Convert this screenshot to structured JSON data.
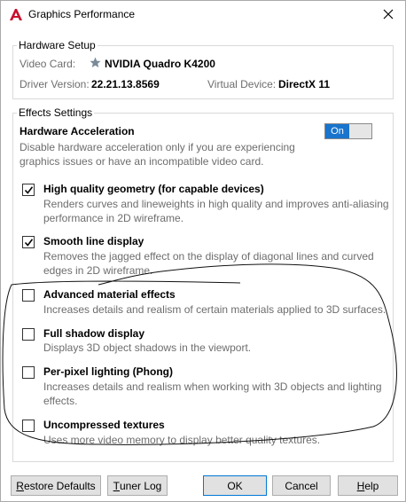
{
  "window": {
    "title": "Graphics Performance"
  },
  "hardware": {
    "legend": "Hardware Setup",
    "video_card_label": "Video Card:",
    "video_card_value": "NVIDIA Quadro K4200",
    "driver_label": "Driver Version:",
    "driver_value": "22.21.13.8569",
    "virtual_label": "Virtual Device:",
    "virtual_value": "DirectX 11"
  },
  "effects": {
    "legend": "Effects Settings",
    "hw_accel_title": "Hardware Acceleration",
    "hw_accel_desc": "Disable hardware acceleration only if you are experiencing graphics issues or have an incompatible video card.",
    "toggle_label": "On",
    "options": [
      {
        "title": "High quality geometry (for capable devices)",
        "desc": "Renders curves and lineweights in high quality and improves anti-aliasing performance in 2D wireframe.",
        "checked": true
      },
      {
        "title": "Smooth line display",
        "desc": "Removes the jagged effect on the display of diagonal lines and curved edges in 2D wireframe.",
        "checked": true
      },
      {
        "title": "Advanced material effects",
        "desc": "Increases details and realism of certain materials applied to 3D surfaces.",
        "checked": false
      },
      {
        "title": "Full shadow display",
        "desc": "Displays 3D object shadows in the viewport.",
        "checked": false
      },
      {
        "title": "Per-pixel lighting (Phong)",
        "desc": "Increases details and realism when working with 3D objects and lighting effects.",
        "checked": false
      },
      {
        "title": "Uncompressed textures",
        "desc": "Uses more video memory to display better quality textures.",
        "checked": false
      }
    ]
  },
  "buttons": {
    "restore_first": "R",
    "restore_rest": "estore Defaults",
    "tuner_first": "T",
    "tuner_rest": "uner Log",
    "ok": "OK",
    "cancel": "Cancel",
    "help_first": "H",
    "help_rest": "elp"
  },
  "colors": {
    "accent": "#1874cd",
    "brand": "#c8102e",
    "text_gray": "#6d6d6d"
  }
}
